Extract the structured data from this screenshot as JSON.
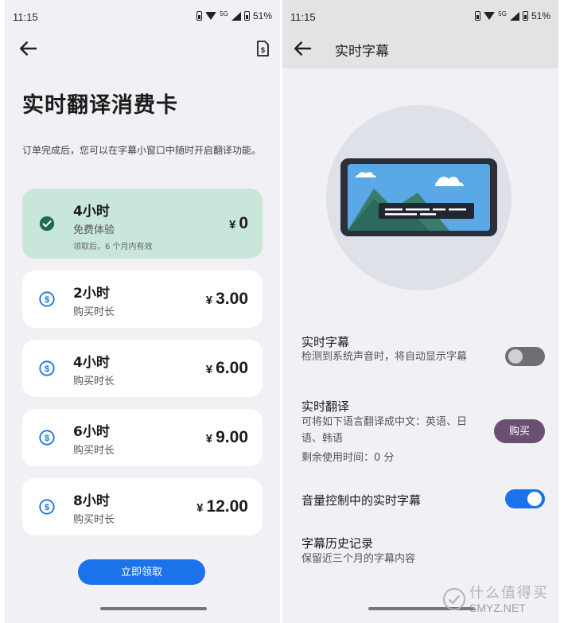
{
  "colors": {
    "panel_bg": "#f1f0f4",
    "selected_card": "#c8e6da",
    "accent_blue": "#1a73e8",
    "buy_purple": "#6b4f73",
    "check_green": "#1e6b54"
  },
  "status": {
    "time": "11:15",
    "network": "5G",
    "battery": "51%"
  },
  "left": {
    "title": "实时翻译消费卡",
    "description": "订单完成后，您可以在字幕小窗口中随时开启翻译功能。",
    "plans": [
      {
        "hours": "4小时",
        "subtitle": "免费体验",
        "note": "领取后，6 个月内有效",
        "currency": "¥",
        "price": "0",
        "selected": true,
        "icon": "check-circle-icon"
      },
      {
        "hours": "2小时",
        "subtitle": "购买时长",
        "currency": "¥",
        "price": "3.00",
        "selected": false,
        "icon": "dollar-circle-icon"
      },
      {
        "hours": "4小时",
        "subtitle": "购买时长",
        "currency": "¥",
        "price": "6.00",
        "selected": false,
        "icon": "dollar-circle-icon"
      },
      {
        "hours": "6小时",
        "subtitle": "购买时长",
        "currency": "¥",
        "price": "9.00",
        "selected": false,
        "icon": "dollar-circle-icon"
      },
      {
        "hours": "8小时",
        "subtitle": "购买时长",
        "currency": "¥",
        "price": "12.00",
        "selected": false,
        "icon": "dollar-circle-icon"
      }
    ],
    "claim_button": "立即领取"
  },
  "right": {
    "title": "实时字幕",
    "settings": {
      "live_caption": {
        "title": "实时字幕",
        "desc": "检测到系统声音时，将自动显示字幕",
        "enabled": false
      },
      "live_translate": {
        "title": "实时翻译",
        "desc": "可将如下语言翻译成中文：英语、日语、韩语",
        "remaining": "剩余使用时间：0 分",
        "buy_label": "购买"
      },
      "volume_caption": {
        "title": "音量控制中的实时字幕",
        "enabled": true
      },
      "caption_history": {
        "title": "字幕历史记录",
        "desc": "保留近三个月的字幕内容"
      }
    }
  },
  "watermark": {
    "cn": "什么值得买",
    "en": "SMYZ.NET"
  }
}
